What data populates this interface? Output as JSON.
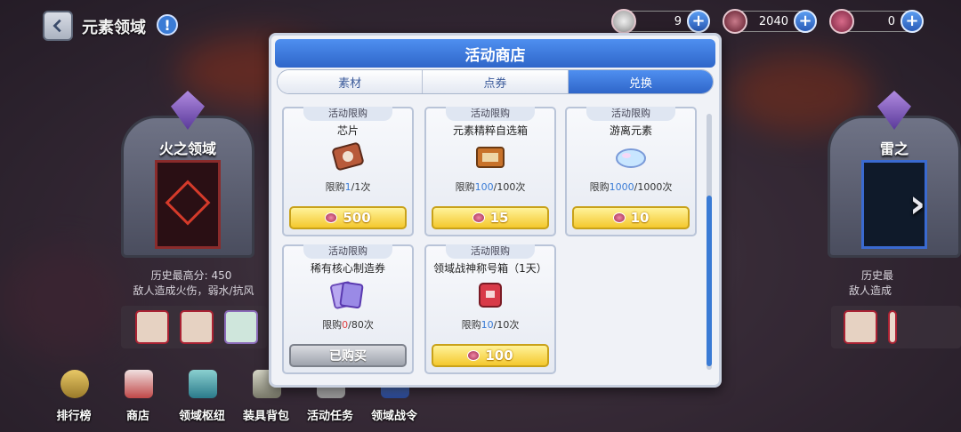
{
  "header": {
    "title": "元素领域"
  },
  "currencies": [
    {
      "value": "9"
    },
    {
      "value": "2040"
    },
    {
      "value": "0"
    }
  ],
  "left_domain": {
    "name": "火之领域",
    "best_score": "历史最高分: 450",
    "desc": "敌人造成火伤，弱水/抗风"
  },
  "right_domain": {
    "name": "雷之",
    "best_score": "历史最",
    "desc": "敌人造成"
  },
  "nav": [
    {
      "label": "排行榜",
      "icon": "trophy-icon"
    },
    {
      "label": "商店",
      "icon": "shop-icon"
    },
    {
      "label": "领域枢纽",
      "icon": "hub-icon"
    },
    {
      "label": "装具背包",
      "icon": "backpack-icon"
    },
    {
      "label": "活动任务",
      "icon": "quest-icon"
    },
    {
      "label": "领域战令",
      "icon": "battle-pass-icon"
    }
  ],
  "shop": {
    "title": "活动商店",
    "tabs": [
      {
        "label": "素材"
      },
      {
        "label": "点券"
      },
      {
        "label": "兑换",
        "active": true
      }
    ],
    "items": [
      {
        "tag": "活动限购",
        "name": "芯片",
        "limit_prefix": "限购",
        "limit_cur": "1",
        "limit_total": "/1次",
        "price": "500",
        "sold": false
      },
      {
        "tag": "活动限购",
        "name": "元素精粹自选箱",
        "limit_prefix": "限购",
        "limit_cur": "100",
        "limit_total": "/100次",
        "price": "15",
        "sold": false
      },
      {
        "tag": "活动限购",
        "name": "游离元素",
        "limit_prefix": "限购",
        "limit_cur": "1000",
        "limit_total": "/1000次",
        "price": "10",
        "sold": false
      },
      {
        "tag": "活动限购",
        "name": "稀有核心制造券",
        "limit_prefix": "限购",
        "limit_cur": "0",
        "limit_total": "/80次",
        "price": "已购买",
        "sold": true
      },
      {
        "tag": "活动限购",
        "name": "领域战神称号箱（1天）",
        "limit_prefix": "限购",
        "limit_cur": "10",
        "limit_total": "/10次",
        "price": "100",
        "sold": false
      }
    ]
  },
  "colors": {
    "accent": "#2f66c9",
    "price_button": "#f4c82e",
    "limit_current": "#3a7bd5"
  }
}
